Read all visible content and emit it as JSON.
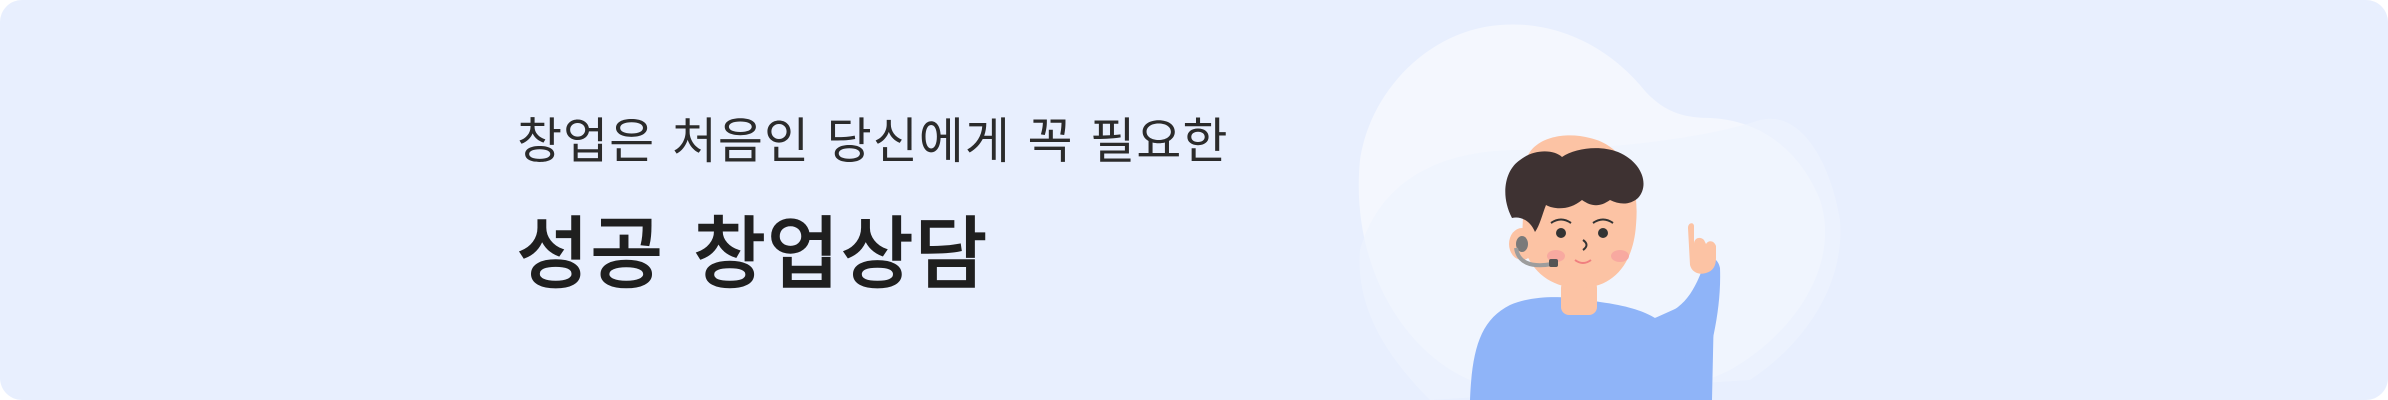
{
  "banner": {
    "subtitle": "창업은 처음인 당신에게 꼭 필요한",
    "title": "성공 창업상담",
    "illustration_icon": "counselor-headset-icon",
    "colors": {
      "background": "#e8effe",
      "bubble": "#f4f7fe",
      "shirt": "#8fb4f8",
      "hair": "#3e3232",
      "skin": "#fcc3a4"
    }
  }
}
